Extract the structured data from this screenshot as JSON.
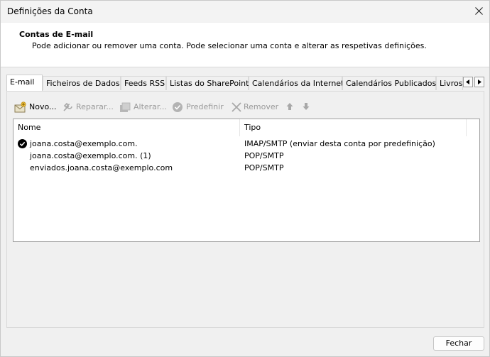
{
  "window": {
    "title": "Definições da Conta"
  },
  "header": {
    "title": "Contas de E-mail",
    "description": "Pode adicionar ou remover uma conta. Pode selecionar uma conta e alterar as respetivas definições."
  },
  "tabs": [
    {
      "label": "E-mail",
      "active": true
    },
    {
      "label": "Ficheiros de Dados"
    },
    {
      "label": "Feeds RSS"
    },
    {
      "label": "Listas do SharePoint"
    },
    {
      "label": "Calendários da Internet"
    },
    {
      "label": "Calendários Publicados"
    },
    {
      "label": "Livros"
    }
  ],
  "toolbar": {
    "new_label": "Novo...",
    "repair_label": "Reparar...",
    "change_label": "Alterar...",
    "default_label": "Predefinir",
    "remove_label": "Remover"
  },
  "accounts": {
    "columns": {
      "name": "Nome",
      "type": "Tipo"
    },
    "rows": [
      {
        "name": "joana.costa@exemplo.com.",
        "type": "IMAP/SMTP (enviar desta conta por predefinição)",
        "default": true
      },
      {
        "name": "joana.costa@exemplo.com. (1)",
        "type": "POP/SMTP"
      },
      {
        "name": "enviados.joana.costa@exemplo.com",
        "type": "POP/SMTP"
      }
    ]
  },
  "footer": {
    "close_label": "Fechar"
  },
  "colors": {
    "disabled_text": "#9a9a9a",
    "window_bg": "#f0f0f0"
  }
}
